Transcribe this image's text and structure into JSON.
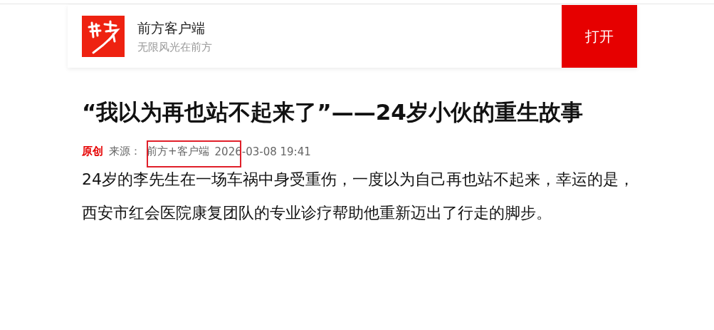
{
  "app_banner": {
    "name": "前方客户端",
    "slogan": "无限风光在前方",
    "open_button": "打开"
  },
  "article": {
    "title": "“我以为再也站不起来了”——24岁小伙的重生故事",
    "meta": {
      "tag": "原创",
      "source_label": "来源：",
      "source": "前方+客户端",
      "time": "2026-03-08 19:41",
      "highlighted": true
    },
    "paragraphs": [
      "24岁的李先生在一场车祸中身受重伤，一度以为自己再也站不起来，幸运的是，西安市红会医院康复团队的专业诊疗帮助他重新迈出了行走的脚步。"
    ]
  }
}
